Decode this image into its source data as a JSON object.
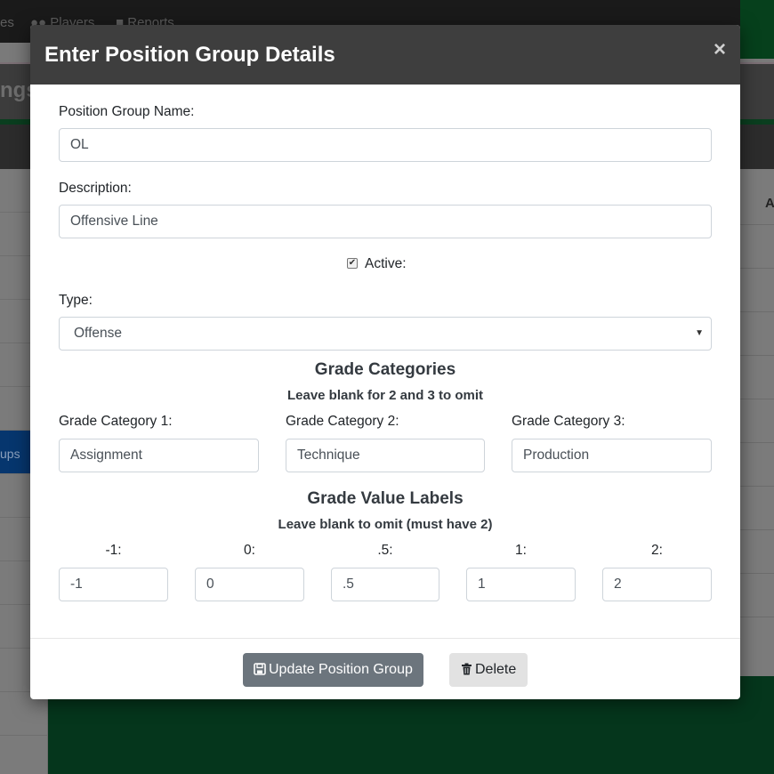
{
  "background": {
    "topnav": {
      "item_es": "es",
      "item_players": "Players",
      "item_reports": "Reports"
    },
    "page_title_fragment": "ngs",
    "sidebar_active_fragment": "ups",
    "column_header_fragment": "A"
  },
  "modal": {
    "title": "Enter Position Group Details",
    "close_label": "×",
    "name_label": "Position Group Name:",
    "name_value": "OL",
    "description_label": "Description:",
    "description_value": "Offensive Line",
    "active_label": "Active:",
    "active_checked": true,
    "type_label": "Type:",
    "type_value": "Offense",
    "grade_categories_heading": "Grade Categories",
    "grade_categories_hint": "Leave blank for 2 and 3 to omit",
    "grade_categories": [
      {
        "label": "Grade Category 1:",
        "value": "Assignment"
      },
      {
        "label": "Grade Category 2:",
        "value": "Technique"
      },
      {
        "label": "Grade Category 3:",
        "value": "Production"
      }
    ],
    "grade_values_heading": "Grade Value Labels",
    "grade_values_hint": "Leave blank to omit (must have 2)",
    "grade_values": [
      {
        "label": "-1:",
        "value": "-1"
      },
      {
        "label": "0:",
        "value": "0"
      },
      {
        "label": ".5:",
        "value": ".5"
      },
      {
        "label": "1:",
        "value": "1"
      },
      {
        "label": "2:",
        "value": "2"
      }
    ],
    "update_button": "Update Position Group",
    "delete_button": "Delete"
  },
  "colors": {
    "modal_header": "#3e3e3e",
    "primary_button": "#6c757d",
    "delete_button": "#e2e2e2",
    "active_sidebar": "#06366e",
    "brand_green": "#05361c"
  },
  "icons": {
    "close": "close-icon",
    "save": "save-icon",
    "trash": "trash-icon",
    "select_caret": "caret-down-icon"
  }
}
